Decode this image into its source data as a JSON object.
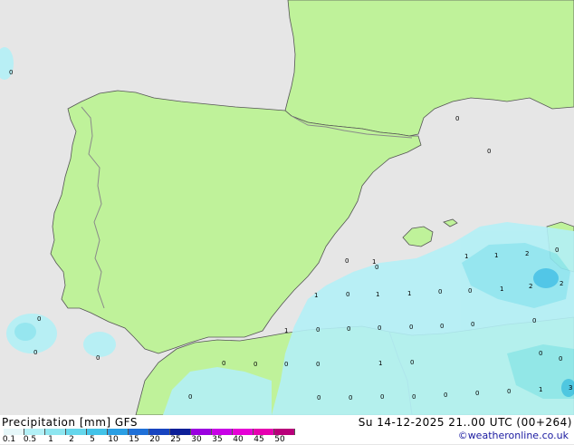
{
  "title_left": "Precipitation [mm]  GFS",
  "title_right": "Su 14-12-2025 21..00 UTC (00+264)",
  "credit": "©weatheronline.co.uk",
  "colors": {
    "land": "#bff29a",
    "sea": "#e6e6e6",
    "border": "#8a8a8a",
    "coast": "#555555"
  },
  "scale": {
    "labels": [
      "0.1",
      "0.5",
      "1",
      "2",
      "5",
      "10",
      "15",
      "20",
      "25",
      "30",
      "35",
      "40",
      "45",
      "50"
    ],
    "colors": [
      "#e6f7f9",
      "#b3f0f6",
      "#8ee6f0",
      "#66d7ec",
      "#43c3e8",
      "#2b9fe4",
      "#1f70d8",
      "#1844c0",
      "#0d1f98",
      "#9b00e0",
      "#c800e6",
      "#e600d6",
      "#e600b0",
      "#b8007a"
    ]
  },
  "value_labels": [
    {
      "text": "0"
    },
    {
      "text": "0"
    },
    {
      "text": "0"
    },
    {
      "text": "0"
    },
    {
      "text": "0"
    },
    {
      "text": "0"
    },
    {
      "text": "0"
    },
    {
      "text": "1"
    },
    {
      "text": "1"
    },
    {
      "text": "2"
    },
    {
      "text": "0"
    },
    {
      "text": "2"
    },
    {
      "text": "2"
    },
    {
      "text": "0"
    },
    {
      "text": "1"
    },
    {
      "text": "1"
    },
    {
      "text": "0"
    },
    {
      "text": "1"
    },
    {
      "text": "1"
    },
    {
      "text": "0"
    },
    {
      "text": "0"
    },
    {
      "text": "1"
    },
    {
      "text": "1"
    },
    {
      "text": "0"
    },
    {
      "text": "0"
    },
    {
      "text": "0"
    },
    {
      "text": "0"
    },
    {
      "text": "0"
    },
    {
      "text": "0"
    },
    {
      "text": "0"
    },
    {
      "text": "0"
    },
    {
      "text": "0"
    },
    {
      "text": "0"
    },
    {
      "text": "1"
    },
    {
      "text": "0"
    },
    {
      "text": "0"
    },
    {
      "text": "0"
    },
    {
      "text": "1"
    },
    {
      "text": "3"
    },
    {
      "text": "0"
    },
    {
      "text": "0"
    },
    {
      "text": "0"
    },
    {
      "text": "0"
    },
    {
      "text": "0"
    },
    {
      "text": "0"
    },
    {
      "text": "0"
    },
    {
      "text": "0"
    },
    {
      "text": "0"
    }
  ]
}
